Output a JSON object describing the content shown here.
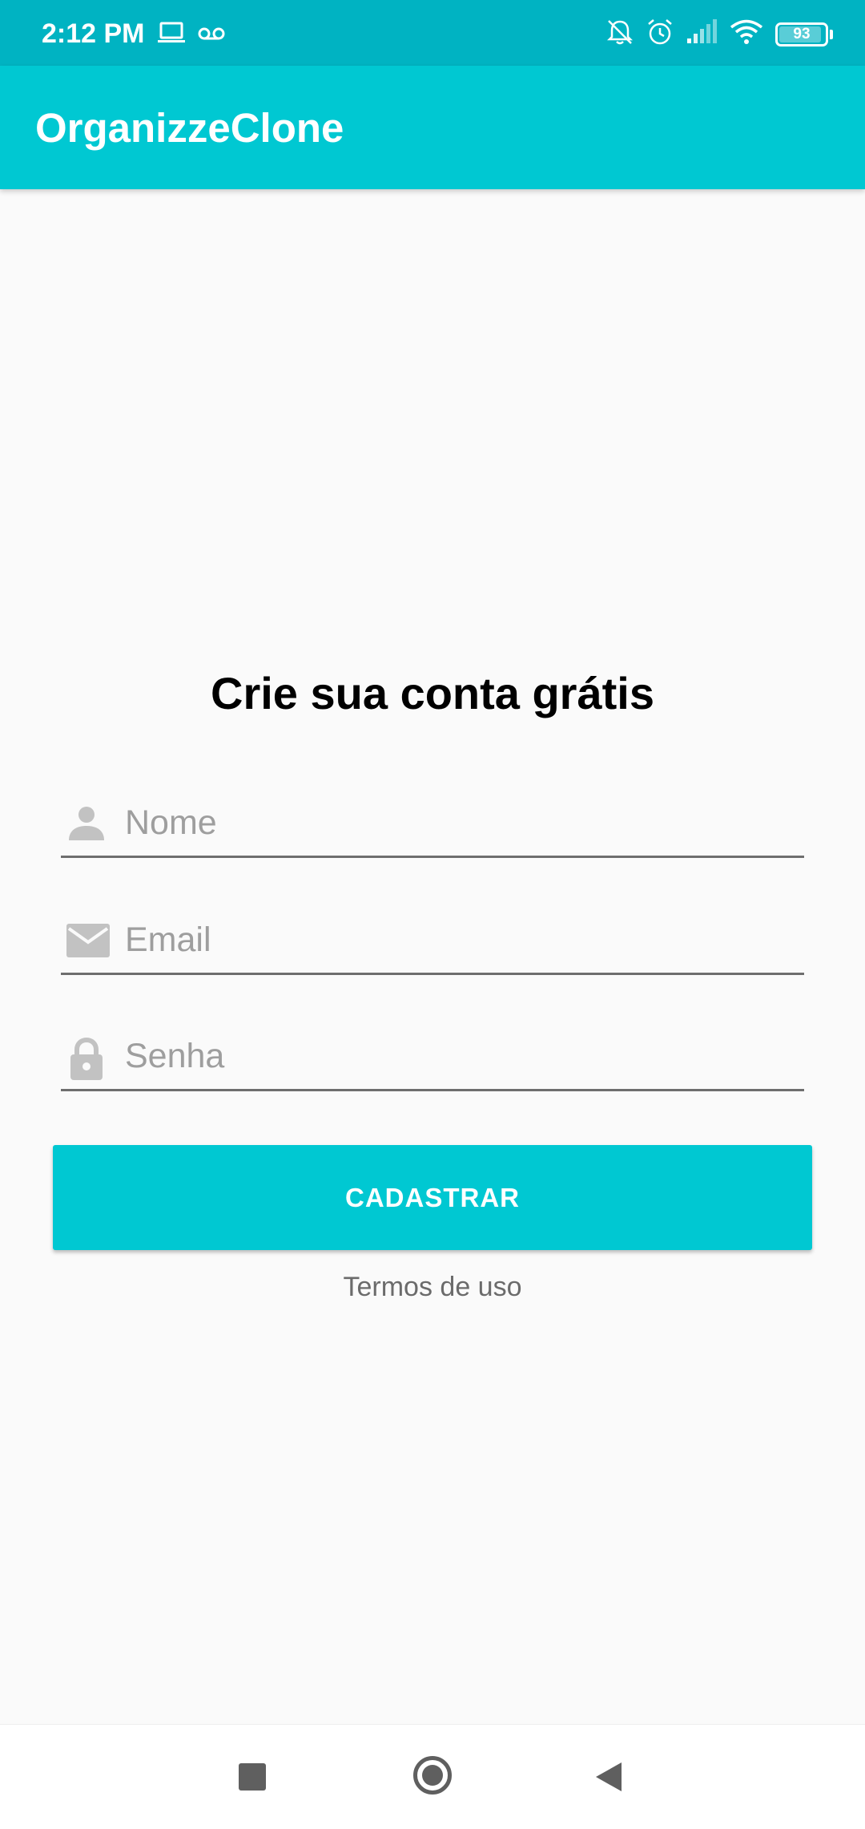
{
  "status_bar": {
    "time": "2:12 PM",
    "left_icons": [
      "laptop-icon",
      "voicemail-icon"
    ],
    "right_icons": [
      "bell-off-icon",
      "alarm-icon",
      "signal-icon",
      "wifi-icon"
    ],
    "battery_level": "93"
  },
  "app_bar": {
    "title": "OrganizzeClone"
  },
  "form": {
    "heading": "Crie sua conta grátis",
    "name_field": {
      "placeholder": "Nome",
      "value": "",
      "icon": "person-icon"
    },
    "email_field": {
      "placeholder": "Email",
      "value": "",
      "icon": "mail-icon"
    },
    "password_field": {
      "placeholder": "Senha",
      "value": "",
      "icon": "lock-icon"
    },
    "submit_label": "CADASTRAR",
    "terms_label": "Termos de uso"
  },
  "nav_bar": {
    "buttons": [
      "recent-apps-icon",
      "home-icon",
      "back-icon"
    ]
  },
  "colors": {
    "status_bar": "#00b3c2",
    "primary": "#00c8d2",
    "background": "#fafafa",
    "placeholder_text": "#9e9e9e",
    "input_underline": "#6e6e6e"
  }
}
